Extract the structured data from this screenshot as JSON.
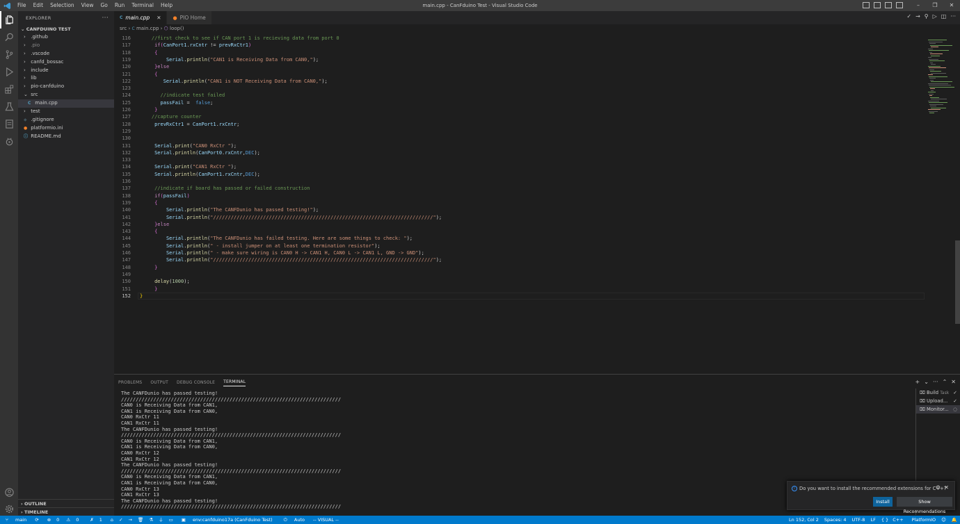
{
  "window": {
    "title": "main.cpp - CanFduino Test - Visual Studio Code"
  },
  "menu": [
    "File",
    "Edit",
    "Selection",
    "View",
    "Go",
    "Run",
    "Terminal",
    "Help"
  ],
  "explorer": {
    "header": "EXPLORER",
    "section": "CANFDUINO TEST",
    "items": [
      {
        "label": ".github",
        "type": "folder"
      },
      {
        "label": ".pio",
        "type": "folder"
      },
      {
        "label": ".vscode",
        "type": "folder"
      },
      {
        "label": "canfd_bossac",
        "type": "folder"
      },
      {
        "label": "include",
        "type": "folder"
      },
      {
        "label": "lib",
        "type": "folder"
      },
      {
        "label": "pio-canfduino",
        "type": "folder"
      },
      {
        "label": "src",
        "type": "folder-open"
      },
      {
        "label": "main.cpp",
        "type": "cpp"
      },
      {
        "label": "test",
        "type": "folder"
      },
      {
        "label": ".gitignore",
        "type": "git"
      },
      {
        "label": "platformio.ini",
        "type": "pio"
      },
      {
        "label": "README.md",
        "type": "md"
      }
    ],
    "outline": "OUTLINE",
    "timeline": "TIMELINE"
  },
  "tabs": [
    {
      "label": "main.cpp",
      "active": true
    },
    {
      "label": "PIO Home",
      "active": false
    }
  ],
  "breadcrumb": {
    "folder": "src",
    "file": "main.cpp",
    "symbol": "loop()"
  },
  "code": {
    "lines": [
      "116",
      "117",
      "118",
      "119",
      "120",
      "121",
      "122",
      "123",
      "124",
      "125",
      "126",
      "127",
      "128",
      "129",
      "130",
      "131",
      "132",
      "133",
      "134",
      "135",
      "136",
      "137",
      "138",
      "139",
      "140",
      "141",
      "142",
      "143",
      "144",
      "145",
      "146",
      "147",
      "148",
      "149",
      "150",
      "151",
      "152"
    ]
  },
  "panel": {
    "tabs": [
      "PROBLEMS",
      "OUTPUT",
      "DEBUG CONSOLE",
      "TERMINAL"
    ],
    "terminal_lines": [
      "The CANFDunio has passed testing!",
      "///////////////////////////////////////////////////////////////////////////",
      "CAN0 is Receiving Data from CAN1,",
      "CAN1 is Receiving Data from CAN0,",
      "CAN0 RxCtr 11",
      "CAN1 RxCtr 11",
      "The CANFDunio has passed testing!",
      "///////////////////////////////////////////////////////////////////////////",
      "CAN0 is Receiving Data from CAN1,",
      "CAN1 is Receiving Data from CAN0,",
      "CAN0 RxCtr 12",
      "CAN1 RxCtr 12",
      "The CANFDunio has passed testing!",
      "///////////////////////////////////////////////////////////////////////////",
      "CAN0 is Receiving Data from CAN1,",
      "CAN1 is Receiving Data from CAN0,",
      "CAN0 RxCtr 13",
      "CAN1 RxCtr 13",
      "The CANFDunio has passed testing!",
      "///////////////////////////////////////////////////////////////////////////"
    ],
    "terminals": [
      {
        "label": "Build",
        "sub": "Task"
      },
      {
        "label": "Upload...",
        "sub": ""
      },
      {
        "label": "Monitor...",
        "sub": ""
      }
    ]
  },
  "notification": {
    "message": "Do you want to install the recommended extensions for C++?",
    "install": "Install",
    "show": "Show Recommendations"
  },
  "status": {
    "branch": "main",
    "errors": "0",
    "warnings": "0",
    "ports": "1",
    "env": "env:canfduino17a (CanFduino Test)",
    "auto": "Auto",
    "mode": "-- VISUAL --",
    "position": "Ln 152, Col 2",
    "spaces": "Spaces: 4",
    "encoding": "UTF-8",
    "eol": "LF",
    "language": "C++",
    "platform": "PlatformIO"
  }
}
